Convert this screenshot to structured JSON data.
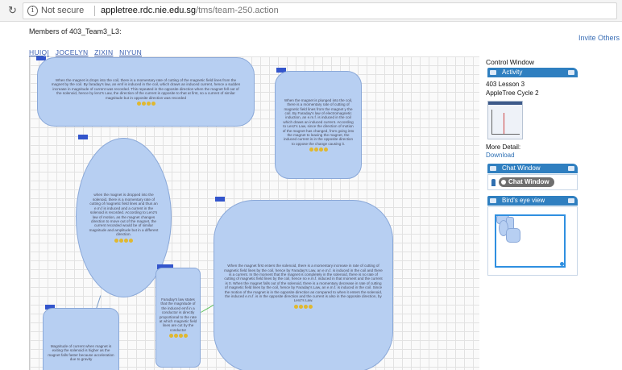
{
  "browser": {
    "security": "Not secure",
    "host": "appletree.rdc.nie.edu.sg",
    "path": "/tms/team-250.action"
  },
  "header": {
    "title": "Members of 403_Team3_L3:",
    "invite": "Invite Others",
    "members": [
      "HUIQI",
      "JOCELYN",
      "ZIXIN",
      "NIYUN"
    ]
  },
  "notes": [
    {
      "id": "note-top",
      "text": "When the magnet is drops into the coil, there is a momentary rate of cutting of the magnetic field lines from the magnet by the coil. By faraday's law, an emf is induced in the coil, which draws an induced current, hence a sudden increase in magnitude of current was recorded. This repeated in the opposite direction when the magnet fell out of the solenoid, hence by lenz's Law, the direction of the current is opposite to that at first, so a current of similar magnitude but in opposite direction was recorded",
      "stars": 4
    },
    {
      "id": "note-right",
      "text": "When the magnet is plunged into the coil, there is a momentary rate of cutting of magnetic field lines from the magnet y the coil. By Faraday's law of electromagnetic induction, an e.m.f. is induced in the coil which draws an induced current. According to Lenz's Law, since the direction of motion of the magnet has changed, from going into the magnet to leaving the magnet, the induced current is in the opposite direction to oppose the change causing it.",
      "stars": 4
    },
    {
      "id": "note-ellipse",
      "text": "when the magnet is dropped into the solenoid, there is a momentary rate of cutting of magnetic field lines and thus an e.m.f is induced and a current in the solenoid is recorded. According to Lenz's law of motion, as the magnet changes direction to move out of the magnet, the current recorded would be of similar magnitude and amplitude but in a different direction.",
      "stars": 4
    },
    {
      "id": "note-large",
      "text": "When the magnet first enters the solenoid, there is a momentary increase in rate of cutting of magnetic field lines by the coil, hence by Faraday's Law, an e.m.f. is induced in the coil and there is a current. In the moment that the magnet is completely in the solenoid, there is no rate of cutting of magnetic field lines by the coil, hence no e.m.f. induced in that moment and the current is 0. When the magnet falls out of the solenoid, there is a momentary decrease in rate of cutting of magnetic field lines by the coil, hence by Faraday's Law, an e.m.f. is induced in the coil. Since the motion of the magnet is in the opposite direction as compared to when it enters the solenoid, the induced e.m.f. is in the opposite direction and the current is also in the opposite direction, by Lenz's Law.",
      "stars": 4
    },
    {
      "id": "note-small",
      "text": "Faraday's law states that the magnitude of the induced emf in a conductor is directly proportional to the rate at which magnetic field lines are cut by the conductor",
      "stars": 4
    },
    {
      "id": "note-bottom",
      "text": "Magnitude of current when magnet is exiting the solenoid is higher as the magnet falls faster because acceleration due to gravity",
      "stars": 0
    }
  ],
  "control": {
    "title": "Control Window",
    "activity_header": "Activity",
    "lesson": "403 Lesson 3",
    "cycle": "AppleTree Cycle 2",
    "more_detail": "More Detail:",
    "download": "Download",
    "chat_header": "Chat Window",
    "chat_button": "Chat Window",
    "bird_header": "Bird's eye view"
  }
}
